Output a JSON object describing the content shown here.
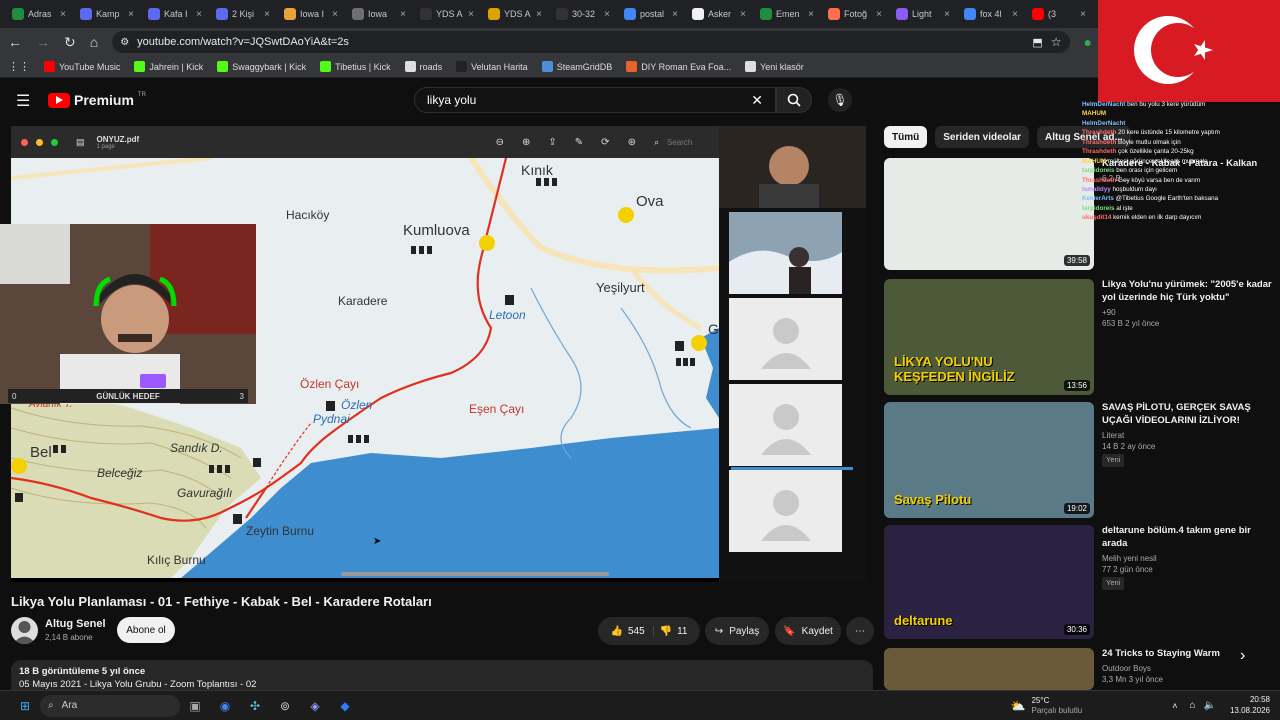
{
  "browser": {
    "tabs": [
      {
        "label": "Adras",
        "color": "#1e8e3e"
      },
      {
        "label": "Kamp",
        "color": "#5b6af0"
      },
      {
        "label": "Kafa I",
        "color": "#5b6af0"
      },
      {
        "label": "2 Kişi",
        "color": "#5b6af0"
      },
      {
        "label": "Iowa I",
        "color": "#e8a33c"
      },
      {
        "label": "Iowa",
        "color": "#6f6f6f"
      },
      {
        "label": "YDS A",
        "color": "#333333"
      },
      {
        "label": "YDS A",
        "color": "#dba300"
      },
      {
        "label": "30-32",
        "color": "#333333"
      },
      {
        "label": "postal",
        "color": "#4285f4"
      },
      {
        "label": "Asker",
        "color": "#f1f1f1"
      },
      {
        "label": "Emen",
        "color": "#1e8e3e"
      },
      {
        "label": "Fotoğ",
        "color": "#ff6f4b"
      },
      {
        "label": "Light",
        "color": "#8b5cf6"
      },
      {
        "label": "fox 4l",
        "color": "#4285f4"
      },
      {
        "label": "(3",
        "color": "#ff0000"
      }
    ],
    "url": "youtube.com/watch?v=JQSwtDAoYiA&t=2s",
    "bookmarks": [
      {
        "label": "YouTube Music",
        "color": "#ff0000"
      },
      {
        "label": "Jahrein | Kick",
        "color": "#53fc18"
      },
      {
        "label": "Swaggybark | Kick",
        "color": "#53fc18"
      },
      {
        "label": "Tibetius | Kick",
        "color": "#53fc18"
      },
      {
        "label": "roads",
        "color": "#dddddd"
      },
      {
        "label": "Velutan Harita",
        "color": "#222222"
      },
      {
        "label": "SteamGridDB",
        "color": "#4a90d9"
      },
      {
        "label": "DIY Roman Eva Foa...",
        "color": "#e8632c"
      },
      {
        "label": "Yeni klasör",
        "color": "#dddddd"
      }
    ]
  },
  "youtube": {
    "logo": "Premium",
    "logo_region": "TR",
    "search_value": "likya yolu",
    "video": {
      "title": "Likya Yolu Planlaması - 01 - Fethiye - Kabak - Bel - Karadere Rotaları",
      "channel": "Altug Senel",
      "subscribers": "2,14 B abone",
      "subscribe_label": "Abone ol",
      "likes": "545",
      "dislikes": "11",
      "share_label": "Paylaş",
      "save_label": "Kaydet",
      "views": "18 B görüntüleme  5 yıl önce",
      "description": "05 Mayıs 2021 - Likya Yolu Grubu - Zoom Toplantısı - 02"
    },
    "pdf": {
      "filename": "ONYUZ.pdf",
      "pages": "1 page",
      "search_placeholder": "Search"
    },
    "map_places": {
      "kinik": "Kınık",
      "ova": "Ova",
      "hacikoy": "Hacıköy",
      "kumluova": "Kumluova",
      "karadere": "Karadere",
      "letoon": "Letoon",
      "yesilyurt": "Yeşilyurt",
      "ozlen_cayi": "Özlen Çayı",
      "ozlen": "Özlen",
      "pydnai": "Pydnai",
      "esen_cayi": "Eşen Çayı",
      "bel": "Bel",
      "belcegiz": "Belceğiz",
      "sandik": "Sandık D.",
      "gavuragili": "Gavurağılı",
      "zeytin": "Zeytin Burnu",
      "kilic": "Kılıç Burnu",
      "g": "G",
      "avlank": "Avlanık T."
    },
    "webcam_label_left": "0",
    "webcam_label_center": "GÜNLÜK HEDEF",
    "webcam_label_right": "3",
    "chips": [
      "Tümü",
      "Seriden videolar",
      "Altug Senel ad..."
    ],
    "recommendations": [
      {
        "title": "Karadere - Kabak - Patara - Kalkan",
        "channel": "",
        "meta": "6,2 B ...",
        "duration": "39:58",
        "badge": ""
      },
      {
        "title": "Likya Yolu'nu yürümek: \"2005'e kadar yol üzerinde hiç Türk yoktu\"",
        "channel": "+90",
        "meta": "653 B  2 yıl önce",
        "duration": "13:56",
        "badge": "",
        "thumb_caption": "LİKYA YOLU'NU KEŞFEDEN İNGİLİZ"
      },
      {
        "title": "SAVAŞ PİLOTU, GERÇEK SAVAŞ UÇAĞI VİDEOLARINI İZLİYOR!",
        "channel": "Literat",
        "meta": "14 B  2 ay önce",
        "duration": "19:02",
        "badge": "Yeni",
        "thumb_caption": "Savaş Pilotu"
      },
      {
        "title": "deltarune bölüm.4 takım gene bir arada",
        "channel": "Melih yeni nesil",
        "meta": "77  2 gün önce",
        "duration": "30:36",
        "badge": "Yeni",
        "thumb_caption": "deltarune"
      },
      {
        "title": "24 Tricks to Staying Warm",
        "channel": "Outdoor Boys",
        "meta": "3,3 Mn  3 yıl önce",
        "duration": "",
        "badge": ""
      }
    ]
  },
  "chat": [
    {
      "user": "HelmDerNacht",
      "color": "#7ec0ff",
      "text": "ben bu yolu 3 kere yürüdüm"
    },
    {
      "user": "MAHUM",
      "color": "#ffd24a",
      "text": ""
    },
    {
      "user": "HelmDerNacht",
      "color": "#7ec0ff",
      "text": ""
    },
    {
      "user": "Thrashdeth",
      "color": "#ff6b6b",
      "text": "20 kere üstünde 15 kilometre yaptım"
    },
    {
      "user": "Thrashdeth",
      "color": "#ff6b6b",
      "text": "Böyle mutlu olmak için"
    },
    {
      "user": "Thrashdeth",
      "color": "#ff6b6b",
      "text": "çok özellikle çanta 20-25kg"
    },
    {
      "user": "MAHUM",
      "color": "#ffd24a",
      "text": "mülteci görünce çekilecek muamele"
    },
    {
      "user": "tarpidoreis",
      "color": "#7ee07e",
      "text": "ben orası için gelicem"
    },
    {
      "user": "Thrashdeth",
      "color": "#ff6b6b",
      "text": "Gey köyü varsa ben de varım"
    },
    {
      "user": "ismaildyy",
      "color": "#b48aff",
      "text": "hoşbuldum dayı"
    },
    {
      "user": "KeklerArts",
      "color": "#7ec0ff",
      "text": "@Tibetius Google Earth'ten baksana"
    },
    {
      "user": "tarpidoreis",
      "color": "#7ee07e",
      "text": "al işte"
    },
    {
      "user": "ukuşdit14",
      "color": "#ff6b6b",
      "text": "kemik elden en ilk darp dayıcım"
    }
  ],
  "taskbar": {
    "search_label": "Ara",
    "weather_temp": "25°C",
    "weather_text": "Parçalı bulutlu",
    "time": "20:58",
    "date": "13.08.2026"
  }
}
